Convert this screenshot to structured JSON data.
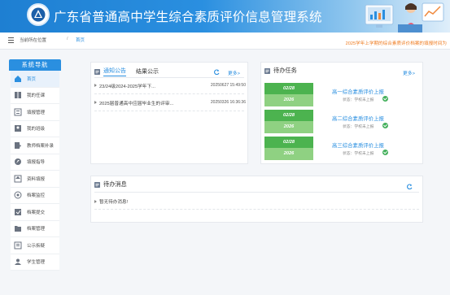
{
  "app": {
    "title": "广东省普通高中学生综合素质评价信息管理系统"
  },
  "breadcrumb": {
    "here": "当前所在位置",
    "sep": "/",
    "home": "首页"
  },
  "marquee": "2025学年上学期的综合素质评价档案的填报时间为",
  "sidebar": {
    "title": "系统导航",
    "items": [
      {
        "label": "首页",
        "icon": "home-icon",
        "active": true
      },
      {
        "label": "我的任课",
        "icon": "book-icon"
      },
      {
        "label": "填报管理",
        "icon": "form-icon"
      },
      {
        "label": "我的班级",
        "icon": "class-icon"
      },
      {
        "label": "教师档案补录",
        "icon": "file-add-icon"
      },
      {
        "label": "填报指导",
        "icon": "compass-icon"
      },
      {
        "label": "资料填报",
        "icon": "upload-icon"
      },
      {
        "label": "档案监控",
        "icon": "monitor-icon"
      },
      {
        "label": "档案提交",
        "icon": "submit-icon"
      },
      {
        "label": "档案管理",
        "icon": "folder-icon"
      },
      {
        "label": "公示拆疑",
        "icon": "notice-icon"
      },
      {
        "label": "学生管理",
        "icon": "user-icon"
      }
    ]
  },
  "notice_panel": {
    "tabs": [
      "通知公告",
      "结果公示"
    ],
    "more": "更多>",
    "rows": [
      {
        "title": "23/24级2024-2025学年下...",
        "date": "20250627 15:49:50"
      },
      {
        "title": "2025届普通高中应届毕业生的评审...",
        "date": "20250326 16:36:36"
      }
    ]
  },
  "task_panel": {
    "title": "待办任务",
    "more": "更多>",
    "items": [
      {
        "date": "02/28",
        "year": "2026",
        "name": "高一综合素质评价上报",
        "status": "状态：学校未上报"
      },
      {
        "date": "02/28",
        "year": "2026",
        "name": "高二综合素质评价上报",
        "status": "状态：学校未上报"
      },
      {
        "date": "02/28",
        "year": "2026",
        "name": "高三综合素质评价上报",
        "status": "状态：学校未上报"
      }
    ]
  },
  "msg_panel": {
    "title": "待办消息",
    "empty": "暂无待办消息!"
  },
  "colors": {
    "primary": "#2a8fe0",
    "task_green": "#4cb34f",
    "task_light": "#8fd182",
    "warning": "#ef7c21"
  }
}
